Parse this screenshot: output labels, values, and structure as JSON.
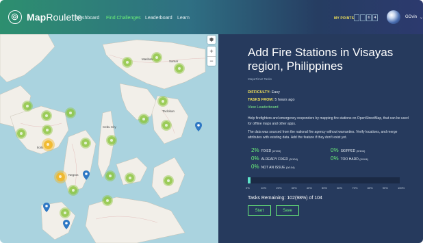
{
  "header": {
    "logo": {
      "bold": "Map",
      "rest": "Roulette"
    },
    "nav": [
      {
        "label": "Dashboard"
      },
      {
        "label": "Find Challenges"
      },
      {
        "label": "Leaderboard"
      },
      {
        "label": "Learn"
      }
    ],
    "points_label": "MY POINTS",
    "points_digits": [
      "",
      "",
      "6",
      "4"
    ],
    "user_name": "GOvin",
    "caret": "⌄"
  },
  "map": {
    "controls": {
      "layers_icon": "layers-icon",
      "zoom_in": "+",
      "zoom_out": "−"
    },
    "labels": [
      "Masbate",
      "Samar",
      "Iloilo",
      "Cebu City",
      "Tacloban",
      "Negros"
    ],
    "colors": {
      "cluster": "#8dc63f",
      "cluster_large": "#f0b728",
      "pin": "#2f78c4",
      "water": "#aad3df",
      "land": "#f2efe9"
    }
  },
  "challenge": {
    "title": "Add Fire Stations in Visayas region, Philippines",
    "owner": "MapaTime! Tasks",
    "difficulty_label": "DIFFICULTY:",
    "difficulty_value": "Easy",
    "tasks_from_label": "TASKS FROM:",
    "tasks_from_value": "5 hours ago",
    "leaderboard_link": "View Leaderboard",
    "description_1": "Help firefighters and emergency responders by mapping fire stations on OpenStreetMap, that can be used for offline maps and other apps.",
    "description_2": "The data was sourced from the national fire agency without warranties. Verify locations, and merge attributes with existing data. Add the feature if they don't exist yet."
  },
  "stats": [
    {
      "pct": "2%",
      "label": "FIXED",
      "count": "(2/104)"
    },
    {
      "pct": "0%",
      "label": "SKIPPED",
      "count": "(0/104)"
    },
    {
      "pct": "0%",
      "label": "ALREADY FIXED",
      "count": "(0/104)"
    },
    {
      "pct": "0%",
      "label": "TOO HARD",
      "count": "(0/104)"
    },
    {
      "pct": "0%",
      "label": "NOT AN ISSUE",
      "count": "(0/104)"
    }
  ],
  "progress": {
    "fraction_complete": 0.02,
    "ticks": [
      "0%",
      "10%",
      "20%",
      "30%",
      "40%",
      "50%",
      "60%",
      "70%",
      "80%",
      "90%",
      "100%"
    ],
    "colors": {
      "fill": "#5fe4c9",
      "track": "#1b2a45"
    }
  },
  "remaining_text": "Tasks Remaining: 102(98%) of 104",
  "buttons": {
    "start": "Start",
    "save": "Save"
  },
  "colors": {
    "accent_green": "#6cf27a",
    "accent_yellow": "#f3e35a",
    "panel_bg": "#263a5d"
  }
}
